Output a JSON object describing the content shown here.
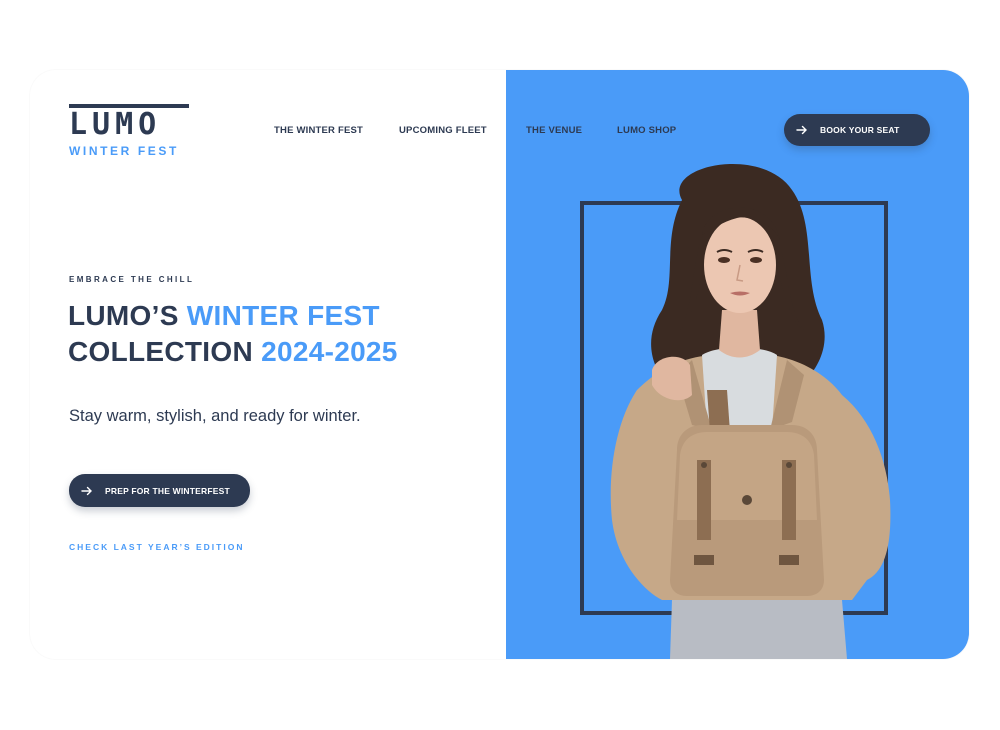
{
  "brand": {
    "logo_word": "LUMO",
    "logo_sub": "WINTER FEST"
  },
  "nav": {
    "items": [
      {
        "label": "THE WINTER FEST"
      },
      {
        "label": "UPCOMING FLEET"
      },
      {
        "label": "THE VENUE"
      },
      {
        "label": "LUMO SHOP"
      }
    ],
    "cta_label": "BOOK YOUR SEAT"
  },
  "hero": {
    "eyebrow": "EMBRACE THE CHILL",
    "headline_line1_a": "LUMO’S ",
    "headline_line1_b": "WINTER FEST",
    "headline_line2_a": "COLLECTION ",
    "headline_line2_b": "2024-2025",
    "subtitle": "Stay warm, stylish, and ready for winter.",
    "primary_cta": "PREP FOR THE WINTERFEST",
    "secondary_link": "CHECK LAST YEAR’S EDITION"
  },
  "colors": {
    "navy": "#2d3a52",
    "accent": "#4a9bf8",
    "background": "#ffffff"
  },
  "icons": {
    "cta_arrow": "arrow-right-icon"
  }
}
